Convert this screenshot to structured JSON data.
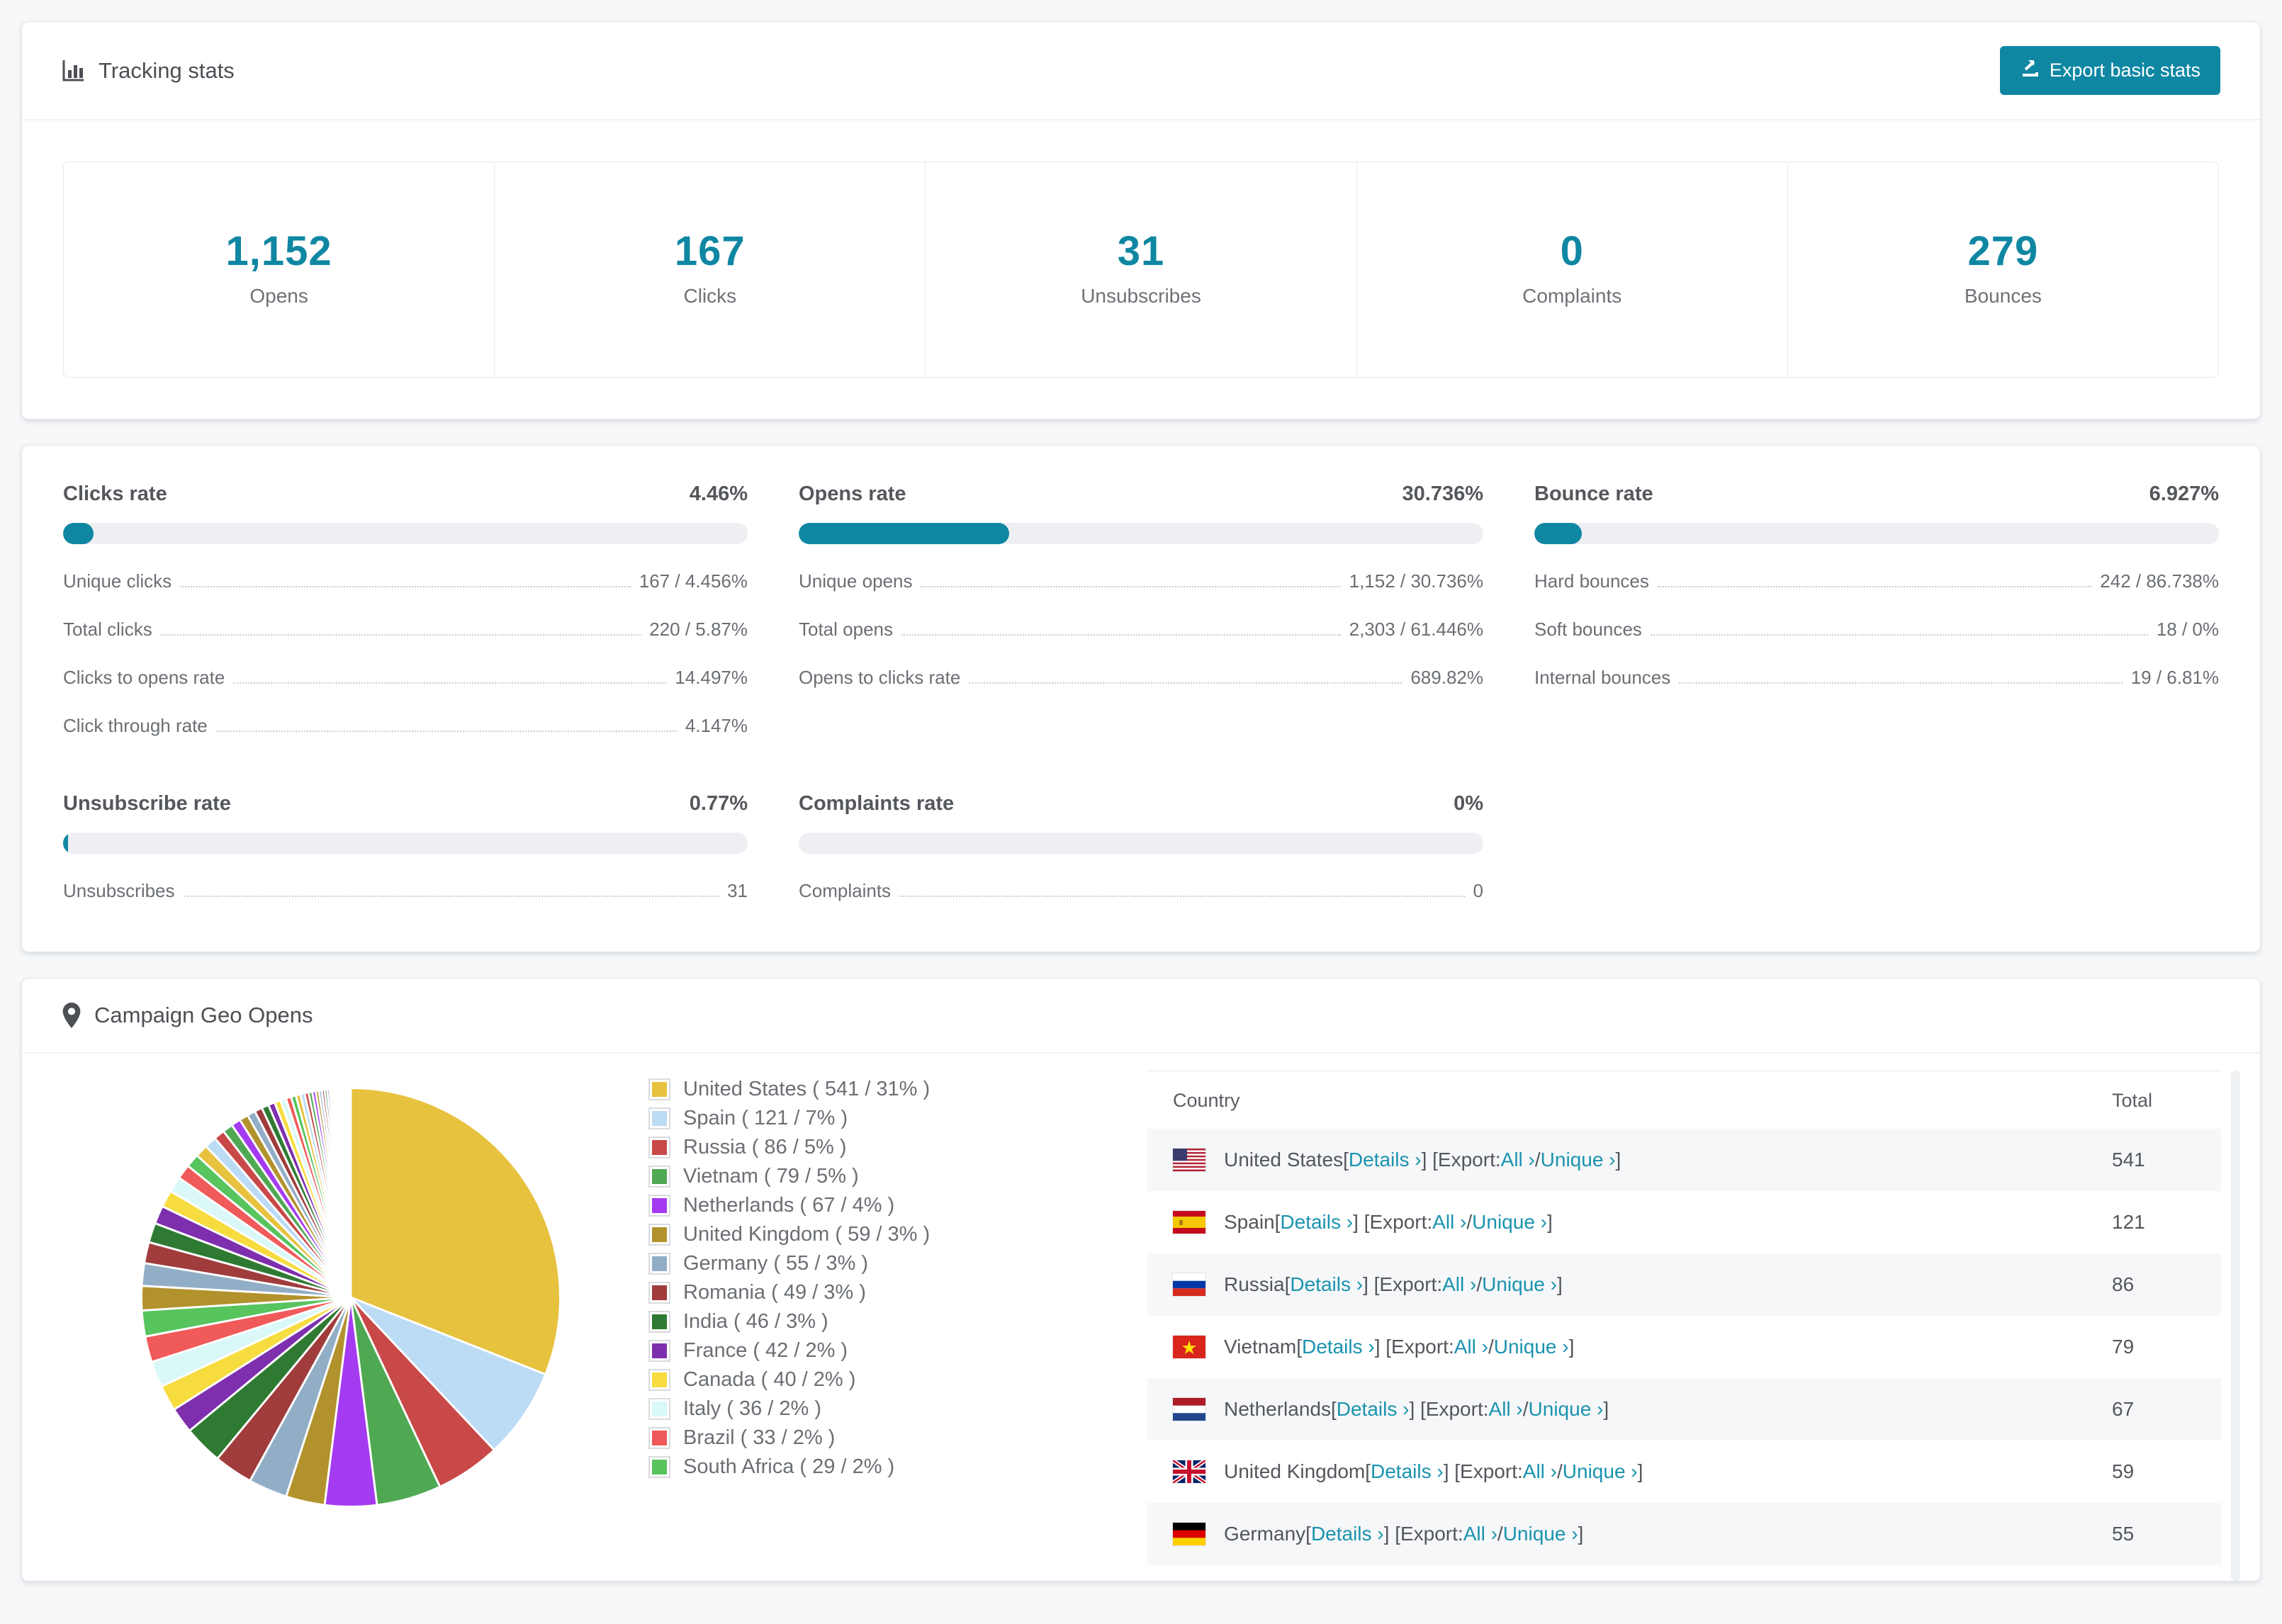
{
  "theme": {
    "accent": "#0f87a3",
    "link": "#1a93af",
    "page_bg": "#f7f8f9"
  },
  "tracking": {
    "title": "Tracking stats",
    "export_label": "Export basic stats",
    "stats": [
      {
        "value": "1,152",
        "label": "Opens"
      },
      {
        "value": "167",
        "label": "Clicks"
      },
      {
        "value": "31",
        "label": "Unsubscribes"
      },
      {
        "value": "0",
        "label": "Complaints"
      },
      {
        "value": "279",
        "label": "Bounces"
      }
    ]
  },
  "rates": [
    {
      "title": "Clicks rate",
      "value": "4.46%",
      "pct": 4.46,
      "rows": [
        [
          "Unique clicks",
          "167 / 4.456%"
        ],
        [
          "Total clicks",
          "220 / 5.87%"
        ],
        [
          "Clicks to opens rate",
          "14.497%"
        ],
        [
          "Click through rate",
          "4.147%"
        ]
      ]
    },
    {
      "title": "Opens rate",
      "value": "30.736%",
      "pct": 30.736,
      "rows": [
        [
          "Unique opens",
          "1,152 / 30.736%"
        ],
        [
          "Total opens",
          "2,303 / 61.446%"
        ],
        [
          "Opens to clicks rate",
          "689.82%"
        ]
      ]
    },
    {
      "title": "Bounce rate",
      "value": "6.927%",
      "pct": 6.927,
      "rows": [
        [
          "Hard bounces",
          "242 / 86.738%"
        ],
        [
          "Soft bounces",
          "18 / 0%"
        ],
        [
          "Internal bounces",
          "19 / 6.81%"
        ]
      ]
    },
    {
      "title": "Unsubscribe rate",
      "value": "0.77%",
      "pct": 0.77,
      "rows": [
        [
          "Unsubscribes",
          "31"
        ]
      ]
    },
    {
      "title": "Complaints rate",
      "value": "0%",
      "pct": 0,
      "rows": [
        [
          "Complaints",
          "0"
        ]
      ]
    }
  ],
  "chart_data": {
    "type": "pie",
    "title": "Campaign Geo Opens",
    "labels": [
      "United States",
      "Spain",
      "Russia",
      "Vietnam",
      "Netherlands",
      "United Kingdom",
      "Germany",
      "Romania",
      "India",
      "France",
      "Canada",
      "Italy",
      "Brazil",
      "South Africa",
      "Others (many small slices)"
    ],
    "values": [
      541,
      121,
      86,
      79,
      67,
      59,
      55,
      49,
      46,
      42,
      40,
      36,
      33,
      29
    ],
    "percents": [
      31,
      7,
      5,
      5,
      4,
      3,
      3,
      3,
      3,
      2,
      2,
      2,
      2,
      2
    ],
    "others_percent": 26,
    "colors": [
      "#e7c23f",
      "#bcdbf5",
      "#c94848",
      "#4fa852",
      "#a43bf0",
      "#b2922c",
      "#92aec6",
      "#a03c3c",
      "#2f7a33",
      "#7e2fae",
      "#f7dc40",
      "#daf8f8",
      "#f05a5a",
      "#57c45e"
    ],
    "start_angle_deg": -90,
    "direction": "clockwise",
    "legend_position": "right"
  },
  "geo": {
    "title": "Campaign Geo Opens",
    "legend": [
      {
        "label": "United States ( 541 / 31% )"
      },
      {
        "label": "Spain ( 121 / 7% )"
      },
      {
        "label": "Russia ( 86 / 5% )"
      },
      {
        "label": "Vietnam ( 79 / 5% )"
      },
      {
        "label": "Netherlands ( 67 / 4% )"
      },
      {
        "label": "United Kingdom ( 59 / 3% )"
      },
      {
        "label": "Germany ( 55 / 3% )"
      },
      {
        "label": "Romania ( 49 / 3% )"
      },
      {
        "label": "India ( 46 / 3% )"
      },
      {
        "label": "France ( 42 / 2% )"
      },
      {
        "label": "Canada ( 40 / 2% )"
      },
      {
        "label": "Italy ( 36 / 2% )"
      },
      {
        "label": "Brazil ( 33 / 2% )"
      },
      {
        "label": "South Africa ( 29 / 2% )"
      }
    ],
    "table": {
      "col_country": "Country",
      "col_total": "Total",
      "links": {
        "details": "Details ›",
        "all": "All ›",
        "unique": "Unique ›"
      },
      "fmt": {
        "t1": " [",
        "t2": "] [Export: ",
        "t3": " / ",
        "t4": "]"
      },
      "rows": [
        {
          "flag": "us",
          "country": "United States",
          "total": "541"
        },
        {
          "flag": "es",
          "country": "Spain",
          "total": "121"
        },
        {
          "flag": "ru",
          "country": "Russia",
          "total": "86"
        },
        {
          "flag": "vn",
          "country": "Vietnam",
          "total": "79"
        },
        {
          "flag": "nl",
          "country": "Netherlands",
          "total": "67"
        },
        {
          "flag": "gb",
          "country": "United Kingdom",
          "total": "59"
        },
        {
          "flag": "de",
          "country": "Germany",
          "total": "55"
        }
      ]
    }
  }
}
